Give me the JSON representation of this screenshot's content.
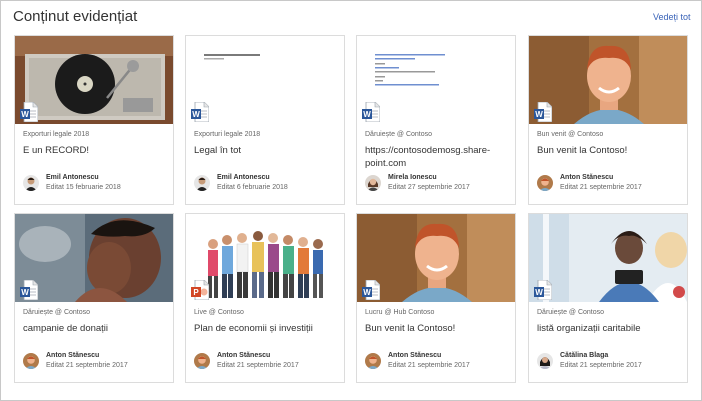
{
  "header": {
    "title": "Conținut evidențiat",
    "see_all": "Vedeți tot"
  },
  "cards": [
    {
      "source": "Exporturi legale 2018",
      "title": "E un RECORD!",
      "author": "Emil Antonescu",
      "edited": "Editat 15 februarie 2018",
      "file_icon": "word-doc-icon"
    },
    {
      "source": "Exporturi legale 2018",
      "title": "Legal în tot",
      "author": "Emil Antonescu",
      "edited": "Editat 6 februarie 2018",
      "file_icon": "word-doc-icon"
    },
    {
      "source": "Dăruiește @ Contoso",
      "title": "https://contosodemosg.share-point.com",
      "author": "Mirela Ionescu",
      "edited": "Editat 27 septembrie 2017",
      "file_icon": "word-doc-icon"
    },
    {
      "source": "Bun venit @ Contoso",
      "title": "Bun venit la Contoso!",
      "author": "Anton Stănescu",
      "edited": "Editat 21 septembrie 2017",
      "file_icon": "word-doc-icon"
    },
    {
      "source": "Dăruiește @ Contoso",
      "title": "campanie de donații",
      "author": "Anton Stănescu",
      "edited": "Editat 21 septembrie 2017",
      "file_icon": "word-doc-icon"
    },
    {
      "source": "Live @ Contoso",
      "title": "Plan de economii și investiții",
      "author": "Anton Stănescu",
      "edited": "Editat 21 septembrie 2017",
      "file_icon": "powerpoint-doc-icon"
    },
    {
      "source": "Lucru @ Hub Contoso",
      "title": "Bun venit la Contoso!",
      "author": "Anton Stănescu",
      "edited": "Editat 21 septembrie 2017",
      "file_icon": "word-doc-icon"
    },
    {
      "source": "Dăruiește @ Contoso",
      "title": "listă organizații caritabile",
      "author": "Cătălina Blaga",
      "edited": "Editat 21 septembrie 2017",
      "file_icon": "word-doc-icon"
    }
  ],
  "colors": {
    "link": "#3a63b8",
    "word": "#2b579a",
    "powerpoint": "#d24726"
  }
}
